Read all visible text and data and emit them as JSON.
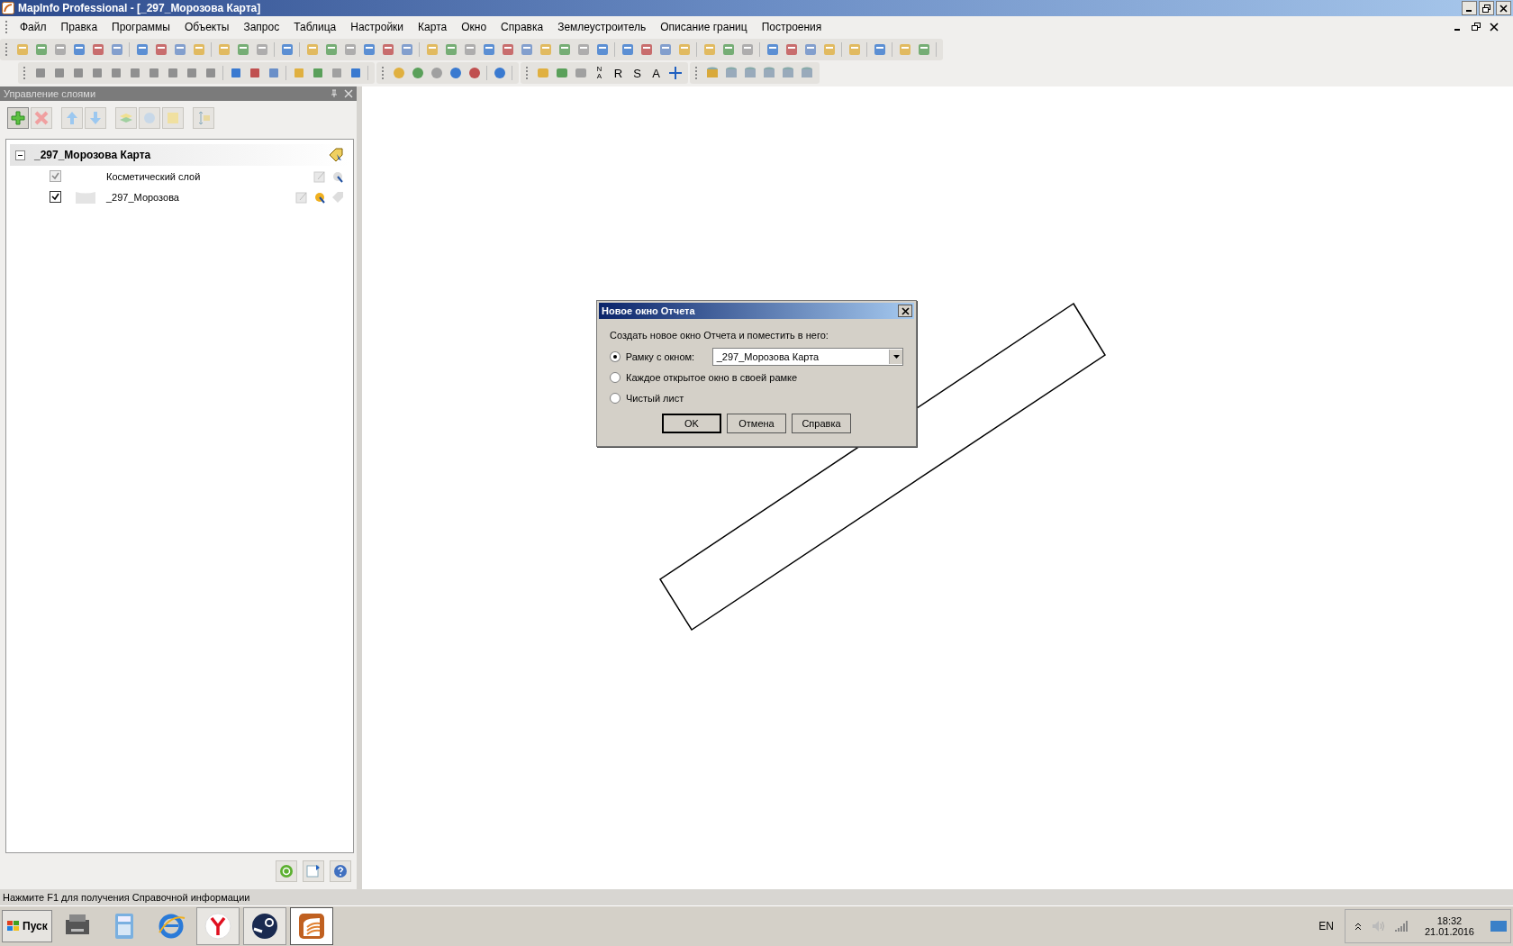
{
  "window": {
    "title": "MapInfo Professional - [_297_Морозова Карта]"
  },
  "menu": [
    "Файл",
    "Правка",
    "Программы",
    "Объекты",
    "Запрос",
    "Таблица",
    "Настройки",
    "Карта",
    "Окно",
    "Справка",
    "Землеустроитель",
    "Описание границ",
    "Построения"
  ],
  "toolbar2": {
    "north_arrow": {
      "top": "N",
      "bottom": "A"
    },
    "glyph_buttons": [
      "R",
      "S",
      "A"
    ]
  },
  "layer_panel": {
    "title": "Управление слоями",
    "map": {
      "name": "_297_Морозова Карта",
      "expanded": true,
      "layers": [
        {
          "name": "Косметический слой",
          "visible": true,
          "disabled": true
        },
        {
          "name": "_297_Морозова",
          "visible": true,
          "disabled": false
        }
      ]
    }
  },
  "dialog": {
    "title": "Новое окно Отчета",
    "prompt": "Создать новое окно Отчета и поместить в него:",
    "options": [
      {
        "label": "Рамку с окном:",
        "selected": true
      },
      {
        "label": "Каждое открытое окно в своей рамке",
        "selected": false
      },
      {
        "label": "Чистый лист",
        "selected": false
      }
    ],
    "window_select": {
      "value": "_297_Морозова Карта"
    },
    "buttons": [
      "OK",
      "Отмена",
      "Справка"
    ]
  },
  "status_bar": "Нажмите F1 для получения Справочной информации",
  "taskbar": {
    "start": "Пуск",
    "apps": [
      {
        "kind": "printer",
        "running": false,
        "selected": false
      },
      {
        "kind": "calculator",
        "running": false,
        "selected": false
      },
      {
        "kind": "browser",
        "running": false,
        "selected": false
      },
      {
        "kind": "yandex",
        "running": true,
        "selected": false
      },
      {
        "kind": "steam",
        "running": true,
        "selected": false
      },
      {
        "kind": "mapinfo",
        "running": true,
        "selected": true
      }
    ],
    "language": "EN",
    "time": "18:32",
    "date": "21.01.2016"
  }
}
